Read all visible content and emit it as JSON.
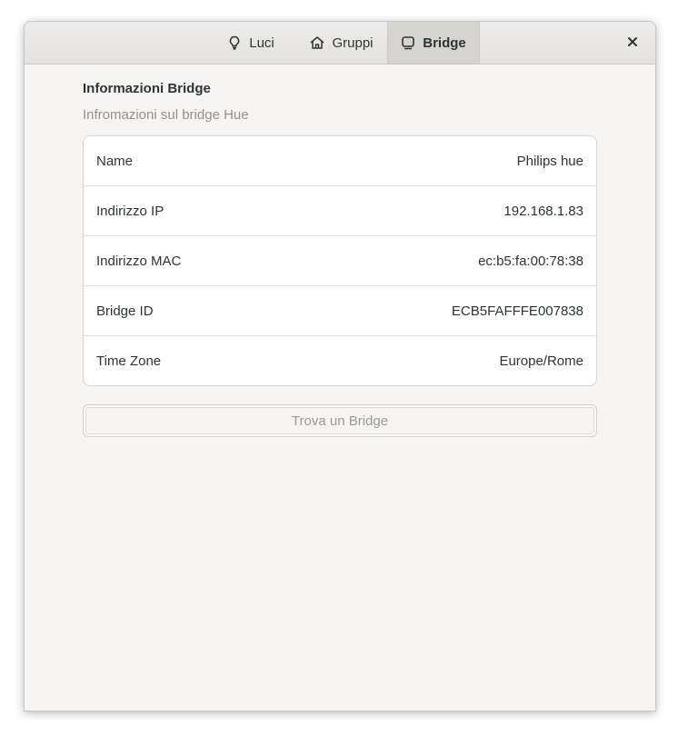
{
  "tabs": [
    {
      "label": "Luci",
      "icon": "bulb-icon"
    },
    {
      "label": "Gruppi",
      "icon": "home-icon"
    },
    {
      "label": "Bridge",
      "icon": "bridge-icon"
    }
  ],
  "active_tab": "Bridge",
  "close_icon": "close-icon",
  "bridge": {
    "title": "Informazioni Bridge",
    "subtitle": "Infromazioni sul bridge Hue",
    "rows": [
      {
        "label": "Name",
        "value": "Philips hue"
      },
      {
        "label": "Indirizzo IP",
        "value": "192.168.1.83"
      },
      {
        "label": "Indirizzo MAC",
        "value": "ec:b5:fa:00:78:38"
      },
      {
        "label": "Bridge ID",
        "value": "ECB5FAFFFE007838"
      },
      {
        "label": "Time Zone",
        "value": "Europe/Rome"
      }
    ],
    "find_button": "Trova un Bridge"
  },
  "colors": {
    "window_bg": "#f6f5f4",
    "text": "#2e3436",
    "dim_text": "#919191",
    "active_tab_bg": "#d6d4d1"
  }
}
